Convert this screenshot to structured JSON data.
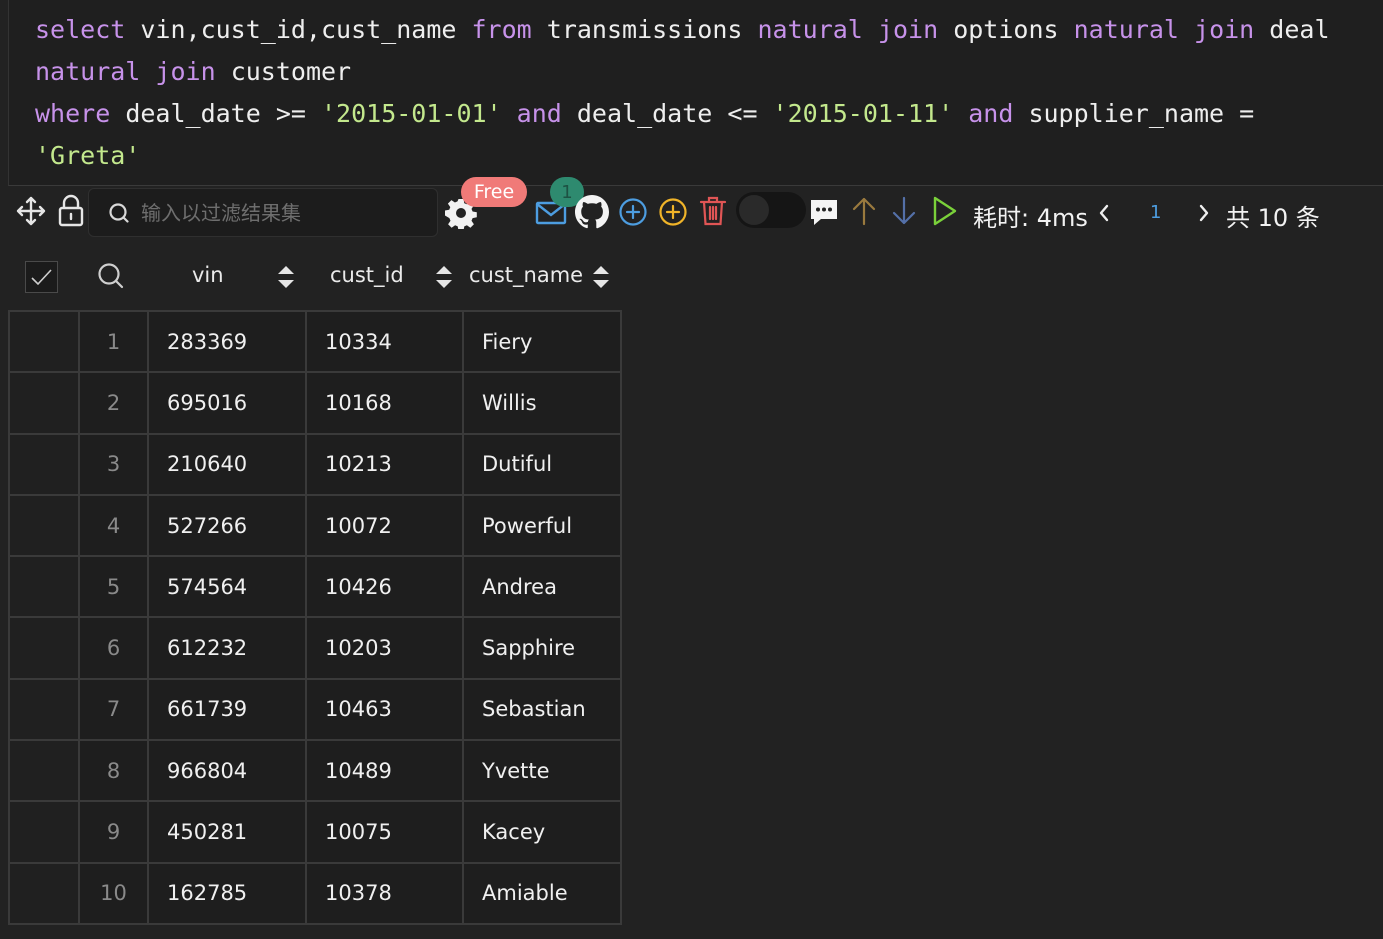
{
  "sql": {
    "lines": [
      [
        [
          "kw",
          "select"
        ],
        [
          "id",
          " vin,cust_id,cust_name "
        ],
        [
          "kw",
          "from"
        ],
        [
          "id",
          " transmissions "
        ],
        [
          "kw",
          "natural"
        ],
        [
          "id",
          " "
        ],
        [
          "kw",
          "join"
        ],
        [
          "id",
          " options "
        ],
        [
          "kw",
          "natural"
        ],
        [
          "id",
          " "
        ],
        [
          "kw",
          "join"
        ],
        [
          "id",
          " deal"
        ]
      ],
      [
        [
          "kw",
          "natural"
        ],
        [
          "id",
          " "
        ],
        [
          "kw",
          "join"
        ],
        [
          "id",
          " customer"
        ]
      ],
      [
        [
          "kw",
          "where"
        ],
        [
          "id",
          " deal_date >= "
        ],
        [
          "str",
          "'2015-01-01'"
        ],
        [
          "id",
          " "
        ],
        [
          "kw",
          "and"
        ],
        [
          "id",
          " deal_date <= "
        ],
        [
          "str",
          "'2015-01-11'"
        ],
        [
          "id",
          " "
        ],
        [
          "kw",
          "and"
        ],
        [
          "id",
          " supplier_name ="
        ]
      ],
      [
        [
          "str",
          "'Greta'"
        ]
      ]
    ]
  },
  "toolbar": {
    "search_placeholder": "输入以过滤结果集",
    "free_badge": "Free",
    "notif_count": "1",
    "timing": "耗时: 4ms",
    "page": "1",
    "total": "共 10 条"
  },
  "columns": [
    "vin",
    "cust_id",
    "cust_name"
  ],
  "rows": [
    [
      "1",
      "283369",
      "10334",
      "Fiery"
    ],
    [
      "2",
      "695016",
      "10168",
      "Willis"
    ],
    [
      "3",
      "210640",
      "10213",
      "Dutiful"
    ],
    [
      "4",
      "527266",
      "10072",
      "Powerful"
    ],
    [
      "5",
      "574564",
      "10426",
      "Andrea"
    ],
    [
      "6",
      "612232",
      "10203",
      "Sapphire"
    ],
    [
      "7",
      "661739",
      "10463",
      "Sebastian"
    ],
    [
      "8",
      "966804",
      "10489",
      "Yvette"
    ],
    [
      "9",
      "450281",
      "10075",
      "Kacey"
    ],
    [
      "10",
      "162785",
      "10378",
      "Amiable"
    ]
  ],
  "colors": {
    "keyword": "#c792ea",
    "string": "#c3e88d",
    "link": "#4d9de0",
    "delete": "#e05555",
    "add_orange": "#f0b429"
  }
}
